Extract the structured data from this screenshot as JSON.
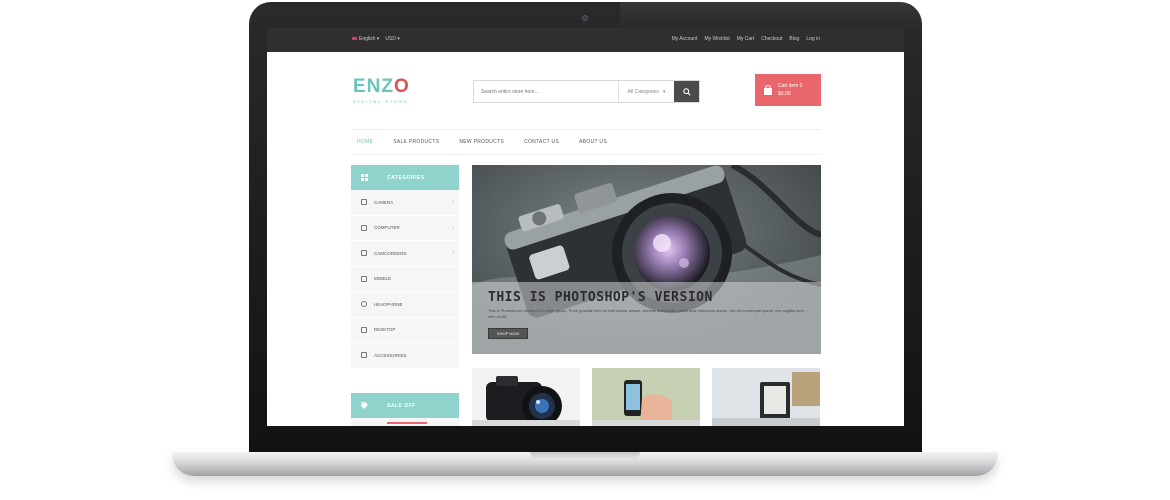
{
  "topbar": {
    "language": "English",
    "currency": "USD",
    "links": [
      "My Account",
      "My Wishlist",
      "My Cart",
      "Checkout",
      "Blog",
      "Log in"
    ]
  },
  "logo": {
    "name_part1": "ENZ",
    "name_part2": "O",
    "tagline": "DIGITAL STORE"
  },
  "search": {
    "placeholder": "Search entire store here...",
    "category": "All Categories"
  },
  "cart": {
    "line1": "Cart item 0",
    "line2": "$0.00"
  },
  "nav": {
    "items": [
      {
        "label": "HOME",
        "active": true
      },
      {
        "label": "SALE PRODUCTS",
        "active": false
      },
      {
        "label": "NEW PRODUCTS",
        "active": false
      },
      {
        "label": "CONTACT US",
        "active": false
      },
      {
        "label": "ABOUT US",
        "active": false
      }
    ]
  },
  "sidebar": {
    "title": "CATEGORIES",
    "items": [
      {
        "label": "CAMERA",
        "icon": "camera-icon",
        "has_arrow": true
      },
      {
        "label": "COMPUTER",
        "icon": "monitor-icon",
        "has_arrow": true
      },
      {
        "label": "CAMCORDERS",
        "icon": "video-icon",
        "has_arrow": true
      },
      {
        "label": "MOBILE",
        "icon": "mobile-icon",
        "has_arrow": false
      },
      {
        "label": "HEADPHONE",
        "icon": "headphone-icon",
        "has_arrow": false
      },
      {
        "label": "DESKTOP",
        "icon": "desktop-icon",
        "has_arrow": false
      },
      {
        "label": "ACCESSORIES",
        "icon": "accessories-icon",
        "has_arrow": false
      }
    ],
    "sale_title": "SALE OFF"
  },
  "slider": {
    "title": "THIS IS PHOTOSHOP'S VERSION",
    "description": "This is Photoshop's version Of Lorem Ipsum. Proin gravida nibh vel velit auctor aliquet. Aenean sollicitudin, lorem quis bibendum auctor, nisi elit consequat ipsum, nec sagittis sem nibh id elit.",
    "button": "SHOP NOW"
  },
  "colors": {
    "accent": "#8fd3cd",
    "logo": "#6cc3bc",
    "cart": "#e9676c",
    "topbar": "#2f2f31"
  }
}
